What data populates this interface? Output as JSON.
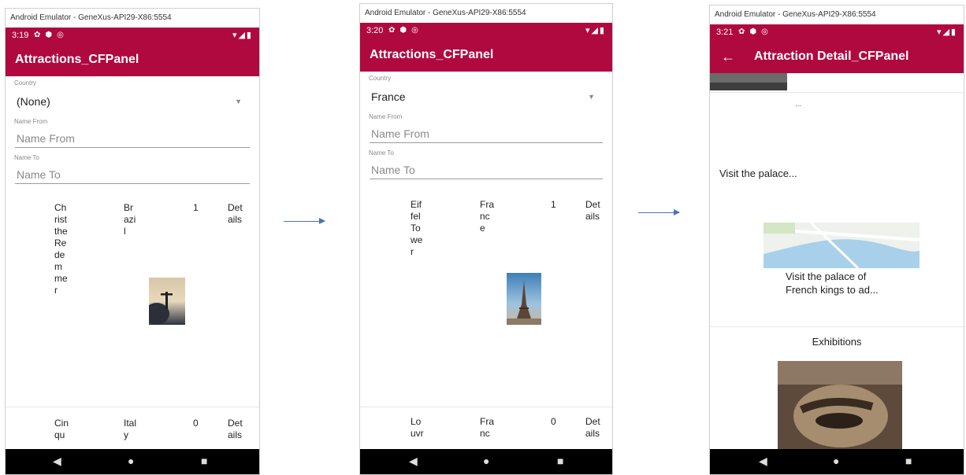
{
  "window_title": "Android Emulator - GeneXus-API29-X86:5554",
  "colors": {
    "primary": "#b0093f",
    "navbar": "#000000",
    "arrow": "#4a72b8"
  },
  "screens": [
    {
      "time": "3:19",
      "status_icons": [
        "gear-icon",
        "shield-icon",
        "sync-icon"
      ],
      "status_right": "▾◢▮",
      "title": "Attractions_CFPanel",
      "country_label": "Country",
      "country_value": "(None)",
      "name_from_label": "Name From",
      "name_from_placeholder": "Name From",
      "name_to_label": "Name To",
      "name_to_placeholder": "Name To",
      "rows": [
        {
          "name": "Christ the Redeemer",
          "name_wrapped": "Ch\nrist\nthe\nRe\nde\nm\nme\nr",
          "country": "Brazil",
          "country_wrapped": "Br\nazi\nl",
          "count": "1",
          "link": "Details",
          "link_wrapped": "Det\nails"
        },
        {
          "name": "Cinqu",
          "name_wrapped": "Cin\nqu",
          "country": "Italy",
          "country_wrapped": "Ital\ny",
          "count": "0",
          "link": "Details",
          "link_wrapped": "Det\nails"
        }
      ]
    },
    {
      "time": "3:20",
      "status_icons": [
        "gear-icon",
        "shield-icon",
        "sync-icon"
      ],
      "status_right": "▾◢▮",
      "title": "Attractions_CFPanel",
      "country_label": "Country",
      "country_value": "France",
      "name_from_label": "Name From",
      "name_from_placeholder": "Name From",
      "name_to_label": "Name To",
      "name_to_placeholder": "Name To",
      "rows": [
        {
          "name": "Eiffel Tower",
          "name_wrapped": "Eif\nfel\nTo\nwe\nr",
          "country": "France",
          "country_wrapped": "Fra\nnc\ne",
          "count": "1",
          "link": "Details",
          "link_wrapped": "Det\nails"
        },
        {
          "name": "Louvr",
          "name_wrapped": "Lo\nuvr",
          "country": "Franc",
          "country_wrapped": "Fra\nnc",
          "count": "0",
          "link": "Details",
          "link_wrapped": "Det\nails"
        }
      ]
    },
    {
      "time": "3:21",
      "status_icons": [
        "gear-icon",
        "shield-icon",
        "sync-icon"
      ],
      "status_right": "▾◢▮",
      "title": "Attraction Detail_CFPanel",
      "ellipsis": "...",
      "description_short": "Visit the palace...",
      "map_caption": "Visit the palace of French kings to ad...",
      "section_title": "Exhibitions"
    }
  ]
}
